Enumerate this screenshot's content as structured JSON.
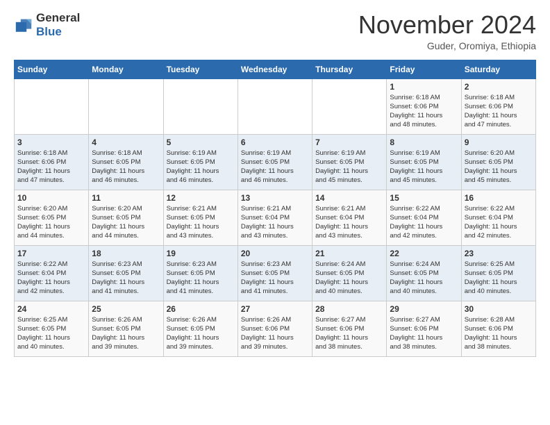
{
  "logo": {
    "general": "General",
    "blue": "Blue"
  },
  "title": "November 2024",
  "location": "Guder, Oromiya, Ethiopia",
  "headers": [
    "Sunday",
    "Monday",
    "Tuesday",
    "Wednesday",
    "Thursday",
    "Friday",
    "Saturday"
  ],
  "weeks": [
    [
      {
        "day": "",
        "info": ""
      },
      {
        "day": "",
        "info": ""
      },
      {
        "day": "",
        "info": ""
      },
      {
        "day": "",
        "info": ""
      },
      {
        "day": "",
        "info": ""
      },
      {
        "day": "1",
        "info": "Sunrise: 6:18 AM\nSunset: 6:06 PM\nDaylight: 11 hours\nand 48 minutes."
      },
      {
        "day": "2",
        "info": "Sunrise: 6:18 AM\nSunset: 6:06 PM\nDaylight: 11 hours\nand 47 minutes."
      }
    ],
    [
      {
        "day": "3",
        "info": "Sunrise: 6:18 AM\nSunset: 6:06 PM\nDaylight: 11 hours\nand 47 minutes."
      },
      {
        "day": "4",
        "info": "Sunrise: 6:18 AM\nSunset: 6:05 PM\nDaylight: 11 hours\nand 46 minutes."
      },
      {
        "day": "5",
        "info": "Sunrise: 6:19 AM\nSunset: 6:05 PM\nDaylight: 11 hours\nand 46 minutes."
      },
      {
        "day": "6",
        "info": "Sunrise: 6:19 AM\nSunset: 6:05 PM\nDaylight: 11 hours\nand 46 minutes."
      },
      {
        "day": "7",
        "info": "Sunrise: 6:19 AM\nSunset: 6:05 PM\nDaylight: 11 hours\nand 45 minutes."
      },
      {
        "day": "8",
        "info": "Sunrise: 6:19 AM\nSunset: 6:05 PM\nDaylight: 11 hours\nand 45 minutes."
      },
      {
        "day": "9",
        "info": "Sunrise: 6:20 AM\nSunset: 6:05 PM\nDaylight: 11 hours\nand 45 minutes."
      }
    ],
    [
      {
        "day": "10",
        "info": "Sunrise: 6:20 AM\nSunset: 6:05 PM\nDaylight: 11 hours\nand 44 minutes."
      },
      {
        "day": "11",
        "info": "Sunrise: 6:20 AM\nSunset: 6:05 PM\nDaylight: 11 hours\nand 44 minutes."
      },
      {
        "day": "12",
        "info": "Sunrise: 6:21 AM\nSunset: 6:05 PM\nDaylight: 11 hours\nand 43 minutes."
      },
      {
        "day": "13",
        "info": "Sunrise: 6:21 AM\nSunset: 6:04 PM\nDaylight: 11 hours\nand 43 minutes."
      },
      {
        "day": "14",
        "info": "Sunrise: 6:21 AM\nSunset: 6:04 PM\nDaylight: 11 hours\nand 43 minutes."
      },
      {
        "day": "15",
        "info": "Sunrise: 6:22 AM\nSunset: 6:04 PM\nDaylight: 11 hours\nand 42 minutes."
      },
      {
        "day": "16",
        "info": "Sunrise: 6:22 AM\nSunset: 6:04 PM\nDaylight: 11 hours\nand 42 minutes."
      }
    ],
    [
      {
        "day": "17",
        "info": "Sunrise: 6:22 AM\nSunset: 6:04 PM\nDaylight: 11 hours\nand 42 minutes."
      },
      {
        "day": "18",
        "info": "Sunrise: 6:23 AM\nSunset: 6:05 PM\nDaylight: 11 hours\nand 41 minutes."
      },
      {
        "day": "19",
        "info": "Sunrise: 6:23 AM\nSunset: 6:05 PM\nDaylight: 11 hours\nand 41 minutes."
      },
      {
        "day": "20",
        "info": "Sunrise: 6:23 AM\nSunset: 6:05 PM\nDaylight: 11 hours\nand 41 minutes."
      },
      {
        "day": "21",
        "info": "Sunrise: 6:24 AM\nSunset: 6:05 PM\nDaylight: 11 hours\nand 40 minutes."
      },
      {
        "day": "22",
        "info": "Sunrise: 6:24 AM\nSunset: 6:05 PM\nDaylight: 11 hours\nand 40 minutes."
      },
      {
        "day": "23",
        "info": "Sunrise: 6:25 AM\nSunset: 6:05 PM\nDaylight: 11 hours\nand 40 minutes."
      }
    ],
    [
      {
        "day": "24",
        "info": "Sunrise: 6:25 AM\nSunset: 6:05 PM\nDaylight: 11 hours\nand 40 minutes."
      },
      {
        "day": "25",
        "info": "Sunrise: 6:26 AM\nSunset: 6:05 PM\nDaylight: 11 hours\nand 39 minutes."
      },
      {
        "day": "26",
        "info": "Sunrise: 6:26 AM\nSunset: 6:05 PM\nDaylight: 11 hours\nand 39 minutes."
      },
      {
        "day": "27",
        "info": "Sunrise: 6:26 AM\nSunset: 6:06 PM\nDaylight: 11 hours\nand 39 minutes."
      },
      {
        "day": "28",
        "info": "Sunrise: 6:27 AM\nSunset: 6:06 PM\nDaylight: 11 hours\nand 38 minutes."
      },
      {
        "day": "29",
        "info": "Sunrise: 6:27 AM\nSunset: 6:06 PM\nDaylight: 11 hours\nand 38 minutes."
      },
      {
        "day": "30",
        "info": "Sunrise: 6:28 AM\nSunset: 6:06 PM\nDaylight: 11 hours\nand 38 minutes."
      }
    ]
  ]
}
